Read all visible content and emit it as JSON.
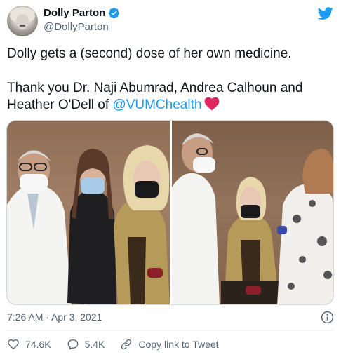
{
  "user": {
    "display_name": "Dolly Parton",
    "handle": "@DollyParton",
    "verified": true
  },
  "tweet": {
    "line1": "Dolly gets a (second) dose of her own medicine.",
    "line2": "Thank you Dr. Naji Abumrad, Andrea Calhoun and",
    "line3_prefix": "Heather O'Dell of ",
    "mention": "@VUMChealth",
    "emoji": "heart-emoji"
  },
  "meta": {
    "timestamp": "7:26 AM · Apr 3, 2021"
  },
  "actions": {
    "likes": "74.6K",
    "replies": "5.4K",
    "copy_link": "Copy link to Tweet"
  },
  "colors": {
    "accent": "#1d9bf0",
    "heart": "#e0245e",
    "secondary_text": "#536471"
  },
  "icons": [
    "verified-badge-icon",
    "twitter-bird-icon",
    "heart-emoji",
    "info-icon",
    "like-icon",
    "reply-icon",
    "link-icon"
  ]
}
